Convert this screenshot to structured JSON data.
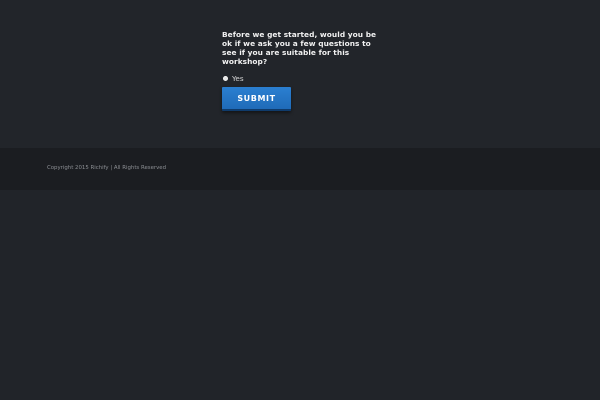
{
  "form": {
    "question": "Before we get started, would you be ok if we ask you a few questions to see if you are suitable for this workshop?",
    "options": [
      {
        "label": "Yes",
        "selected": false
      }
    ],
    "submit_label": "SUBMIT"
  },
  "footer": {
    "copyright": "Copyright 2015 Richify | All Rights Reserved"
  },
  "colors": {
    "page_background": "#212429",
    "footer_background": "#1b1d21",
    "button_blue": "#2377c8"
  }
}
